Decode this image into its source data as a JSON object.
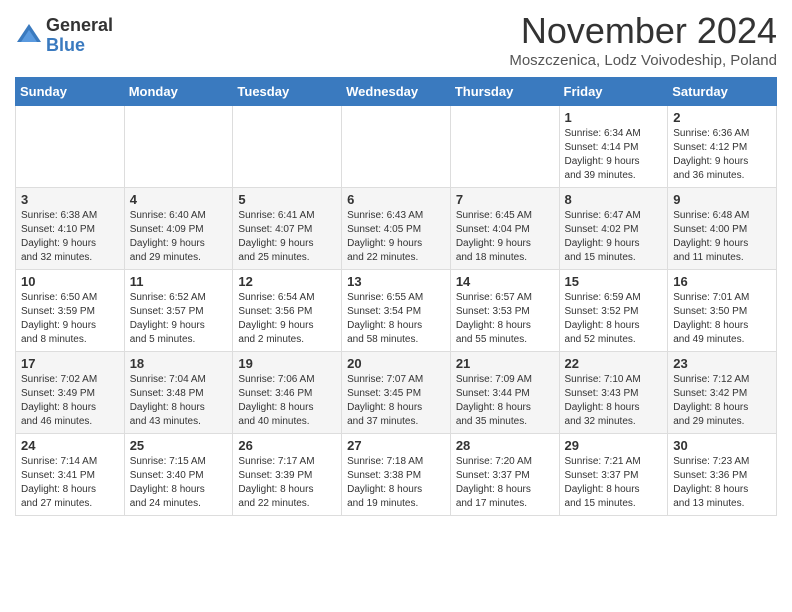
{
  "header": {
    "logo_general": "General",
    "logo_blue": "Blue",
    "month_title": "November 2024",
    "location": "Moszczenica, Lodz Voivodeship, Poland"
  },
  "weekdays": [
    "Sunday",
    "Monday",
    "Tuesday",
    "Wednesday",
    "Thursday",
    "Friday",
    "Saturday"
  ],
  "weeks": [
    [
      {
        "day": "",
        "info": ""
      },
      {
        "day": "",
        "info": ""
      },
      {
        "day": "",
        "info": ""
      },
      {
        "day": "",
        "info": ""
      },
      {
        "day": "",
        "info": ""
      },
      {
        "day": "1",
        "info": "Sunrise: 6:34 AM\nSunset: 4:14 PM\nDaylight: 9 hours\nand 39 minutes."
      },
      {
        "day": "2",
        "info": "Sunrise: 6:36 AM\nSunset: 4:12 PM\nDaylight: 9 hours\nand 36 minutes."
      }
    ],
    [
      {
        "day": "3",
        "info": "Sunrise: 6:38 AM\nSunset: 4:10 PM\nDaylight: 9 hours\nand 32 minutes."
      },
      {
        "day": "4",
        "info": "Sunrise: 6:40 AM\nSunset: 4:09 PM\nDaylight: 9 hours\nand 29 minutes."
      },
      {
        "day": "5",
        "info": "Sunrise: 6:41 AM\nSunset: 4:07 PM\nDaylight: 9 hours\nand 25 minutes."
      },
      {
        "day": "6",
        "info": "Sunrise: 6:43 AM\nSunset: 4:05 PM\nDaylight: 9 hours\nand 22 minutes."
      },
      {
        "day": "7",
        "info": "Sunrise: 6:45 AM\nSunset: 4:04 PM\nDaylight: 9 hours\nand 18 minutes."
      },
      {
        "day": "8",
        "info": "Sunrise: 6:47 AM\nSunset: 4:02 PM\nDaylight: 9 hours\nand 15 minutes."
      },
      {
        "day": "9",
        "info": "Sunrise: 6:48 AM\nSunset: 4:00 PM\nDaylight: 9 hours\nand 11 minutes."
      }
    ],
    [
      {
        "day": "10",
        "info": "Sunrise: 6:50 AM\nSunset: 3:59 PM\nDaylight: 9 hours\nand 8 minutes."
      },
      {
        "day": "11",
        "info": "Sunrise: 6:52 AM\nSunset: 3:57 PM\nDaylight: 9 hours\nand 5 minutes."
      },
      {
        "day": "12",
        "info": "Sunrise: 6:54 AM\nSunset: 3:56 PM\nDaylight: 9 hours\nand 2 minutes."
      },
      {
        "day": "13",
        "info": "Sunrise: 6:55 AM\nSunset: 3:54 PM\nDaylight: 8 hours\nand 58 minutes."
      },
      {
        "day": "14",
        "info": "Sunrise: 6:57 AM\nSunset: 3:53 PM\nDaylight: 8 hours\nand 55 minutes."
      },
      {
        "day": "15",
        "info": "Sunrise: 6:59 AM\nSunset: 3:52 PM\nDaylight: 8 hours\nand 52 minutes."
      },
      {
        "day": "16",
        "info": "Sunrise: 7:01 AM\nSunset: 3:50 PM\nDaylight: 8 hours\nand 49 minutes."
      }
    ],
    [
      {
        "day": "17",
        "info": "Sunrise: 7:02 AM\nSunset: 3:49 PM\nDaylight: 8 hours\nand 46 minutes."
      },
      {
        "day": "18",
        "info": "Sunrise: 7:04 AM\nSunset: 3:48 PM\nDaylight: 8 hours\nand 43 minutes."
      },
      {
        "day": "19",
        "info": "Sunrise: 7:06 AM\nSunset: 3:46 PM\nDaylight: 8 hours\nand 40 minutes."
      },
      {
        "day": "20",
        "info": "Sunrise: 7:07 AM\nSunset: 3:45 PM\nDaylight: 8 hours\nand 37 minutes."
      },
      {
        "day": "21",
        "info": "Sunrise: 7:09 AM\nSunset: 3:44 PM\nDaylight: 8 hours\nand 35 minutes."
      },
      {
        "day": "22",
        "info": "Sunrise: 7:10 AM\nSunset: 3:43 PM\nDaylight: 8 hours\nand 32 minutes."
      },
      {
        "day": "23",
        "info": "Sunrise: 7:12 AM\nSunset: 3:42 PM\nDaylight: 8 hours\nand 29 minutes."
      }
    ],
    [
      {
        "day": "24",
        "info": "Sunrise: 7:14 AM\nSunset: 3:41 PM\nDaylight: 8 hours\nand 27 minutes."
      },
      {
        "day": "25",
        "info": "Sunrise: 7:15 AM\nSunset: 3:40 PM\nDaylight: 8 hours\nand 24 minutes."
      },
      {
        "day": "26",
        "info": "Sunrise: 7:17 AM\nSunset: 3:39 PM\nDaylight: 8 hours\nand 22 minutes."
      },
      {
        "day": "27",
        "info": "Sunrise: 7:18 AM\nSunset: 3:38 PM\nDaylight: 8 hours\nand 19 minutes."
      },
      {
        "day": "28",
        "info": "Sunrise: 7:20 AM\nSunset: 3:37 PM\nDaylight: 8 hours\nand 17 minutes."
      },
      {
        "day": "29",
        "info": "Sunrise: 7:21 AM\nSunset: 3:37 PM\nDaylight: 8 hours\nand 15 minutes."
      },
      {
        "day": "30",
        "info": "Sunrise: 7:23 AM\nSunset: 3:36 PM\nDaylight: 8 hours\nand 13 minutes."
      }
    ]
  ]
}
